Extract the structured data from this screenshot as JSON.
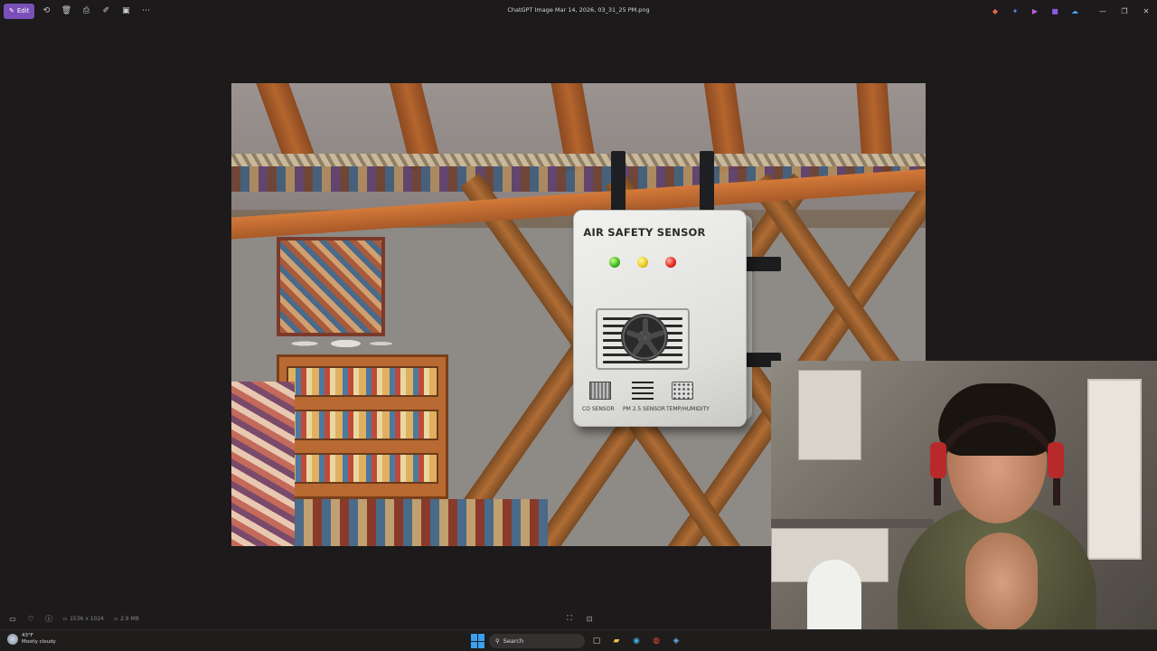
{
  "window": {
    "title": "ChatGPT Image Mar 14, 2026, 03_31_25 PM.png",
    "edit_label": "Edit"
  },
  "toolbar": {
    "icons": [
      "edit-icon",
      "rotate-icon",
      "delete-icon",
      "print-icon",
      "edit-image-icon",
      "crop-icon",
      "more-icon"
    ]
  },
  "photo": {
    "sensor_title": "AIR SAFETY SENSOR",
    "labels": {
      "co": "CO SENSOR",
      "pm": "PM 2.5 SENSOR",
      "temp": "TEMP/HUMIDITY"
    },
    "led_colors": [
      "#3ab31a",
      "#e6c817",
      "#e0261a"
    ]
  },
  "viewer_bar": {
    "dimensions": "1536 x 1024",
    "file_size": "2.9 MB"
  },
  "taskbar": {
    "weather_temp": "43°F",
    "weather_desc": "Mostly cloudy",
    "search_label": "Search"
  }
}
